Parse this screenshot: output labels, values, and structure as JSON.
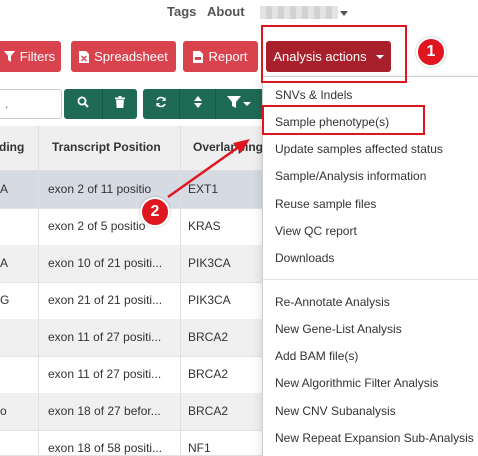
{
  "nav": {
    "tags": "Tags",
    "about": "About"
  },
  "toolbar": {
    "filters": "Filters",
    "spreadsheet": "Spreadsheet",
    "report": "Report",
    "analysis_actions": "Analysis actions"
  },
  "search": {
    "value": "."
  },
  "table": {
    "headers": [
      "ding",
      "Transcript Position",
      "Overlapping"
    ],
    "rows": [
      {
        "c0": "A",
        "c1": "exon 2 of 11 positio",
        "c2": "EXT1"
      },
      {
        "c0": "",
        "c1": "exon 2 of 5 positio",
        "c2": "KRAS"
      },
      {
        "c0": "A",
        "c1": "exon 10 of 21 positi...",
        "c2": "PIK3CA"
      },
      {
        "c0": "G",
        "c1": "exon 21 of 21 positi...",
        "c2": "PIK3CA"
      },
      {
        "c0": "",
        "c1": "exon 11 of 27 positi...",
        "c2": "BRCA2"
      },
      {
        "c0": "",
        "c1": "exon 11 of 27 positi...",
        "c2": "BRCA2"
      },
      {
        "c0": "o",
        "c1": "exon 18 of 27 befor...",
        "c2": "BRCA2"
      },
      {
        "c0": "",
        "c1": "exon 18 of 58 positi...",
        "c2": "NF1"
      }
    ]
  },
  "dropdown": {
    "group1": [
      "SNVs & Indels",
      "Sample phenotype(s)",
      "Update samples affected status",
      "Sample/Analysis information",
      "Reuse sample files",
      "View QC report",
      "Downloads"
    ],
    "group2": [
      "Re-Annotate Analysis",
      "New Gene-List Analysis",
      "Add BAM file(s)",
      "New Algorithmic Filter Analysis",
      "New CNV Subanalysis",
      "New Repeat Expansion Sub-Analysis"
    ]
  },
  "annotations": {
    "marker1": "1",
    "marker2": "2",
    "color": "#e0151f"
  },
  "colors": {
    "red_button": "#d9434d",
    "dark_red_button": "#a8202b",
    "teal_button": "#1f6a55"
  }
}
